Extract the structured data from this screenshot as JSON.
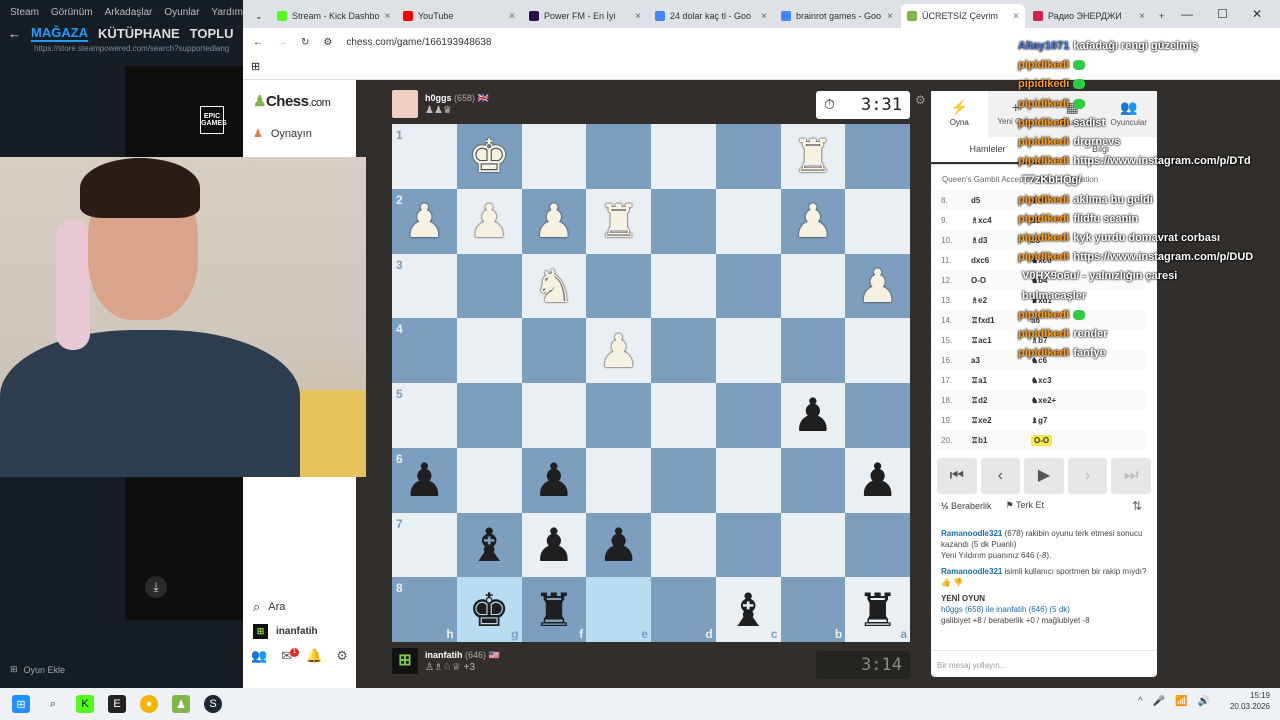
{
  "steam": {
    "menu": [
      "Steam",
      "Görünüm",
      "Arkadaşlar",
      "Oyunlar",
      "Yardım"
    ],
    "nav": [
      "MAĞAZA",
      "KÜTÜPHANE",
      "TOPLU"
    ],
    "url": "https://store.steampowered.com/search?supportedlang",
    "add_game": "Oyun Ekle",
    "epic_logo": "EPIC GAMES"
  },
  "browser": {
    "tabs": [
      {
        "title": "Stream - Kick Dashbo",
        "color": "#53fc18"
      },
      {
        "title": "YouTube",
        "color": "#ff0000"
      },
      {
        "title": "Power FM - En İyi",
        "color": "#2b0f4a"
      },
      {
        "title": "24 dolar kaç tl - Goo",
        "color": "#4285f4"
      },
      {
        "title": "brainrot games - Goo",
        "color": "#4285f4"
      },
      {
        "title": "ÜCRETSİZ Çevrim",
        "color": "#81b64c"
      },
      {
        "title": "Радио ЭНЕРДЖИ",
        "color": "#d41f4f"
      }
    ],
    "url": "chess.com/game/166193948638"
  },
  "sidebar": {
    "logo": "Chess",
    "logo_suffix": ".com",
    "play": "Oynayın",
    "search": "Ara",
    "user": "inanfatih",
    "notif_count": "1"
  },
  "top_player": {
    "name": "h0ggs",
    "rating": "(658)",
    "clock": "3:31"
  },
  "bottom_player": {
    "name": "inanfatih",
    "rating": "(646)",
    "captures_extra": "+3",
    "clock": "3:14"
  },
  "board": {
    "ranks": [
      "1",
      "2",
      "3",
      "4",
      "5",
      "6",
      "7",
      "8"
    ],
    "files": [
      "h",
      "g",
      "f",
      "e",
      "d",
      "c",
      "b",
      "a"
    ],
    "position": [
      [
        "",
        "wK",
        "",
        "",
        "",
        "",
        "wR",
        ""
      ],
      [
        "wP",
        "wP",
        "wP",
        "wR",
        "",
        "",
        "wP",
        ""
      ],
      [
        "",
        "",
        "wN",
        "",
        "",
        "",
        "",
        "wP"
      ],
      [
        "",
        "",
        "",
        "wP",
        "",
        "",
        "",
        ""
      ],
      [
        "",
        "",
        "",
        "",
        "",
        "",
        "bP",
        ""
      ],
      [
        "bP",
        "",
        "bP",
        "",
        "",
        "",
        "",
        "bP"
      ],
      [
        "",
        "bB",
        "bP",
        "bP",
        "",
        "",
        "",
        ""
      ],
      [
        "",
        "bK",
        "bR",
        "",
        "",
        "bB",
        "",
        "bR"
      ]
    ]
  },
  "panel": {
    "tabs": [
      {
        "label": "Oyna",
        "icon": "⚡"
      },
      {
        "label": "Yeni Oyun",
        "icon": "+"
      },
      {
        "label": "Oyunlar",
        "icon": "▦"
      },
      {
        "label": "Oyuncular",
        "icon": "👥"
      }
    ],
    "sub_tabs": [
      "Hamleler",
      "Bilgi"
    ],
    "opening": "Queen's Gambit Accepted: Central Variation",
    "moves": [
      {
        "n": "8.",
        "w": "d5",
        "b": "♞e8"
      },
      {
        "n": "9.",
        "w": "♗xc4",
        "b": "b5"
      },
      {
        "n": "10.",
        "w": "♗d3",
        "b": "c5"
      },
      {
        "n": "11.",
        "w": "dxc6",
        "b": "♞xc6"
      },
      {
        "n": "12.",
        "w": "O-O",
        "b": "♞b4"
      },
      {
        "n": "13.",
        "w": "♗e2",
        "b": "♛xd1"
      },
      {
        "n": "14.",
        "w": "♖fxd1",
        "b": "a6"
      },
      {
        "n": "15.",
        "w": "♖ac1",
        "b": "♗b7"
      },
      {
        "n": "16.",
        "w": "a3",
        "b": "♞c6"
      },
      {
        "n": "17.",
        "w": "♖a1",
        "b": "♞xc3"
      },
      {
        "n": "18.",
        "w": "♖d2",
        "b": "♞xe2+"
      },
      {
        "n": "19.",
        "w": "♖xe2",
        "b": "♝g7"
      },
      {
        "n": "20.",
        "w": "♖b1",
        "b": "O-O"
      }
    ],
    "draw": "Beraberlik",
    "resign": "Terk Et",
    "chat": {
      "msg1_user": "Ramanoodle321",
      "msg1_text": "(678) rakibin oyunu terk etmesi sonucu kazandı (5 dk Puanlı)",
      "msg1_rating": "Yeni Yıldırım puanınız 646 (-8).",
      "msg2_user": "Ramanoodle321",
      "msg2_text": "isimli kullanıcı sportmen bir rakip mıydı?",
      "new_game": "YENİ OYUN",
      "ng_line": "h0ggs (658) ile inanfatih (646) (5 dk)",
      "ng_stats": "galibiyet +8 / beraberlik +0 / mağlubiyet -8"
    },
    "chat_placeholder": "Bir mesaj yollayın..."
  },
  "overlay": [
    {
      "name": "Altay1071",
      "text": "kafadağı rengi güzelmiş",
      "blue": true
    },
    {
      "name": "pipidikedi",
      "text": "",
      "emote": true
    },
    {
      "name": "pipidikedi",
      "text": "",
      "emote": true
    },
    {
      "name": "pipidikedi",
      "text": "",
      "emote": true
    },
    {
      "name": "pipidikedi",
      "text": "sadist"
    },
    {
      "name": "pipidikedi",
      "text": "drgrnevs"
    },
    {
      "name": "pipidikedi",
      "text": "https://www.instagram.com/p/DTd"
    },
    {
      "name": "",
      "text": "T7zKbHQg/"
    },
    {
      "name": "pipidikedi",
      "text": "aklıma bu geldi"
    },
    {
      "name": "pipidikedi",
      "text": "flidfu seanin"
    },
    {
      "name": "pipidikedi",
      "text": "kyk yurdu domavrat corbası"
    },
    {
      "name": "pipidikedi",
      "text": "https://www.instagram.com/p/DUD"
    },
    {
      "name": "",
      "text": "V0HX9o6u/ - yalnızlığın çaresi"
    },
    {
      "name": "",
      "text": "bulmacaşler"
    },
    {
      "name": "pipidikedi",
      "text": "",
      "emote": true
    },
    {
      "name": "pipidikedi",
      "text": "render"
    },
    {
      "name": "pipidikedi",
      "text": "fanfye"
    }
  ],
  "taskbar": {
    "time": "15:19",
    "date": "20.03.2026"
  }
}
